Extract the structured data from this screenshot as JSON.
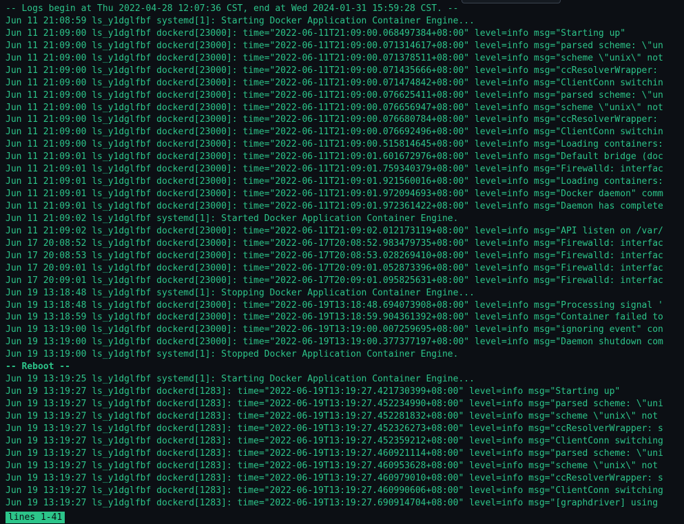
{
  "terminal": {
    "lines": [
      {
        "type": "meta",
        "text": "-- Logs begin at Thu 2022-04-28 12:07:36 CST, end at Wed 2024-01-31 15:59:28 CST. --"
      },
      {
        "type": "log",
        "text": "Jun 11 21:08:59 ls_y1dglfbf systemd[1]: Starting Docker Application Container Engine..."
      },
      {
        "type": "log",
        "text": "Jun 11 21:09:00 ls_y1dglfbf dockerd[23000]: time=\"2022-06-11T21:09:00.068497384+08:00\" level=info msg=\"Starting up\""
      },
      {
        "type": "log",
        "text": "Jun 11 21:09:00 ls_y1dglfbf dockerd[23000]: time=\"2022-06-11T21:09:00.071314617+08:00\" level=info msg=\"parsed scheme: \\\"un"
      },
      {
        "type": "log",
        "text": "Jun 11 21:09:00 ls_y1dglfbf dockerd[23000]: time=\"2022-06-11T21:09:00.071378511+08:00\" level=info msg=\"scheme \\\"unix\\\" not"
      },
      {
        "type": "log",
        "text": "Jun 11 21:09:00 ls_y1dglfbf dockerd[23000]: time=\"2022-06-11T21:09:00.071435666+08:00\" level=info msg=\"ccResolverWrapper:"
      },
      {
        "type": "log",
        "text": "Jun 11 21:09:00 ls_y1dglfbf dockerd[23000]: time=\"2022-06-11T21:09:00.071474842+08:00\" level=info msg=\"ClientConn switchin"
      },
      {
        "type": "log",
        "text": "Jun 11 21:09:00 ls_y1dglfbf dockerd[23000]: time=\"2022-06-11T21:09:00.076625411+08:00\" level=info msg=\"parsed scheme: \\\"un"
      },
      {
        "type": "log",
        "text": "Jun 11 21:09:00 ls_y1dglfbf dockerd[23000]: time=\"2022-06-11T21:09:00.076656947+08:00\" level=info msg=\"scheme \\\"unix\\\" not"
      },
      {
        "type": "log",
        "text": "Jun 11 21:09:00 ls_y1dglfbf dockerd[23000]: time=\"2022-06-11T21:09:00.076680784+08:00\" level=info msg=\"ccResolverWrapper:"
      },
      {
        "type": "log",
        "text": "Jun 11 21:09:00 ls_y1dglfbf dockerd[23000]: time=\"2022-06-11T21:09:00.076692496+08:00\" level=info msg=\"ClientConn switchin"
      },
      {
        "type": "log",
        "text": "Jun 11 21:09:00 ls_y1dglfbf dockerd[23000]: time=\"2022-06-11T21:09:00.515814645+08:00\" level=info msg=\"Loading containers:"
      },
      {
        "type": "log",
        "text": "Jun 11 21:09:01 ls_y1dglfbf dockerd[23000]: time=\"2022-06-11T21:09:01.601672976+08:00\" level=info msg=\"Default bridge (doc"
      },
      {
        "type": "log",
        "text": "Jun 11 21:09:01 ls_y1dglfbf dockerd[23000]: time=\"2022-06-11T21:09:01.759340379+08:00\" level=info msg=\"Firewalld: interfac"
      },
      {
        "type": "log",
        "text": "Jun 11 21:09:01 ls_y1dglfbf dockerd[23000]: time=\"2022-06-11T21:09:01.921560016+08:00\" level=info msg=\"Loading containers:"
      },
      {
        "type": "log",
        "text": "Jun 11 21:09:01 ls_y1dglfbf dockerd[23000]: time=\"2022-06-11T21:09:01.972094693+08:00\" level=info msg=\"Docker daemon\" comm"
      },
      {
        "type": "log",
        "text": "Jun 11 21:09:01 ls_y1dglfbf dockerd[23000]: time=\"2022-06-11T21:09:01.972361422+08:00\" level=info msg=\"Daemon has complete"
      },
      {
        "type": "log",
        "text": "Jun 11 21:09:02 ls_y1dglfbf systemd[1]: Started Docker Application Container Engine."
      },
      {
        "type": "log",
        "text": "Jun 11 21:09:02 ls_y1dglfbf dockerd[23000]: time=\"2022-06-11T21:09:02.012173119+08:00\" level=info msg=\"API listen on /var/"
      },
      {
        "type": "log",
        "text": "Jun 17 20:08:52 ls_y1dglfbf dockerd[23000]: time=\"2022-06-17T20:08:52.983479735+08:00\" level=info msg=\"Firewalld: interfac"
      },
      {
        "type": "log",
        "text": "Jun 17 20:08:53 ls_y1dglfbf dockerd[23000]: time=\"2022-06-17T20:08:53.028269410+08:00\" level=info msg=\"Firewalld: interfac"
      },
      {
        "type": "log",
        "text": "Jun 17 20:09:01 ls_y1dglfbf dockerd[23000]: time=\"2022-06-17T20:09:01.052873396+08:00\" level=info msg=\"Firewalld: interfac"
      },
      {
        "type": "log",
        "text": "Jun 17 20:09:01 ls_y1dglfbf dockerd[23000]: time=\"2022-06-17T20:09:01.095825631+08:00\" level=info msg=\"Firewalld: interfac"
      },
      {
        "type": "log",
        "text": "Jun 19 13:18:48 ls_y1dglfbf systemd[1]: Stopping Docker Application Container Engine..."
      },
      {
        "type": "log",
        "text": "Jun 19 13:18:48 ls_y1dglfbf dockerd[23000]: time=\"2022-06-19T13:18:48.694073908+08:00\" level=info msg=\"Processing signal '"
      },
      {
        "type": "log",
        "text": "Jun 19 13:18:59 ls_y1dglfbf dockerd[23000]: time=\"2022-06-19T13:18:59.904361392+08:00\" level=info msg=\"Container failed to"
      },
      {
        "type": "log",
        "text": "Jun 19 13:19:00 ls_y1dglfbf dockerd[23000]: time=\"2022-06-19T13:19:00.007259695+08:00\" level=info msg=\"ignoring event\" con"
      },
      {
        "type": "log",
        "text": "Jun 19 13:19:00 ls_y1dglfbf dockerd[23000]: time=\"2022-06-19T13:19:00.377377197+08:00\" level=info msg=\"Daemon shutdown com"
      },
      {
        "type": "log",
        "text": "Jun 19 13:19:00 ls_y1dglfbf systemd[1]: Stopped Docker Application Container Engine."
      },
      {
        "type": "reboot",
        "text": "-- Reboot --"
      },
      {
        "type": "log",
        "text": "Jun 19 13:19:25 ls_y1dglfbf systemd[1]: Starting Docker Application Container Engine..."
      },
      {
        "type": "log",
        "text": "Jun 19 13:19:27 ls_y1dglfbf dockerd[1283]: time=\"2022-06-19T13:19:27.421730399+08:00\" level=info msg=\"Starting up\""
      },
      {
        "type": "log",
        "text": "Jun 19 13:19:27 ls_y1dglfbf dockerd[1283]: time=\"2022-06-19T13:19:27.452234990+08:00\" level=info msg=\"parsed scheme: \\\"uni"
      },
      {
        "type": "log",
        "text": "Jun 19 13:19:27 ls_y1dglfbf dockerd[1283]: time=\"2022-06-19T13:19:27.452281832+08:00\" level=info msg=\"scheme \\\"unix\\\" not"
      },
      {
        "type": "log",
        "text": "Jun 19 13:19:27 ls_y1dglfbf dockerd[1283]: time=\"2022-06-19T13:19:27.452326273+08:00\" level=info msg=\"ccResolverWrapper: s"
      },
      {
        "type": "log",
        "text": "Jun 19 13:19:27 ls_y1dglfbf dockerd[1283]: time=\"2022-06-19T13:19:27.452359212+08:00\" level=info msg=\"ClientConn switching"
      },
      {
        "type": "log",
        "text": "Jun 19 13:19:27 ls_y1dglfbf dockerd[1283]: time=\"2022-06-19T13:19:27.460921114+08:00\" level=info msg=\"parsed scheme: \\\"uni"
      },
      {
        "type": "log",
        "text": "Jun 19 13:19:27 ls_y1dglfbf dockerd[1283]: time=\"2022-06-19T13:19:27.460953628+08:00\" level=info msg=\"scheme \\\"unix\\\" not"
      },
      {
        "type": "log",
        "text": "Jun 19 13:19:27 ls_y1dglfbf dockerd[1283]: time=\"2022-06-19T13:19:27.460979010+08:00\" level=info msg=\"ccResolverWrapper: s"
      },
      {
        "type": "log",
        "text": "Jun 19 13:19:27 ls_y1dglfbf dockerd[1283]: time=\"2022-06-19T13:19:27.460990606+08:00\" level=info msg=\"ClientConn switching"
      },
      {
        "type": "log",
        "text": "Jun 19 13:19:27 ls_y1dglfbf dockerd[1283]: time=\"2022-06-19T13:19:27.690914704+08:00\" level=info msg=\"[graphdriver] using"
      }
    ],
    "status": "lines 1-41"
  }
}
